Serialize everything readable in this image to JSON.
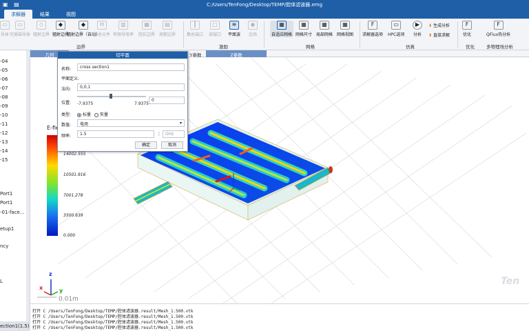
{
  "titlebar": {
    "path": "C:/Users/TenFong/Desktop/TEMP/腔体滤波器.emg"
  },
  "menu": {
    "tabs": [
      "求解器",
      "结果",
      "视图"
    ]
  },
  "ribbon": {
    "buttons": [
      {
        "label": "导体",
        "enabled": false
      },
      {
        "label": "完美磁导体",
        "enabled": false
      },
      {
        "label": "辐射边界",
        "enabled": false
      },
      {
        "label": "辐射边界",
        "enabled": true
      },
      {
        "label": "辐射边界（自动）",
        "enabled": true
      },
      {
        "label": "集总元件",
        "enabled": false
      },
      {
        "label": "有限导电率",
        "enabled": false
      },
      {
        "label": "阻抗边界",
        "enabled": false
      },
      {
        "label": "周期边界",
        "enabled": false
      },
      {
        "label": "集总端口",
        "enabled": false
      },
      {
        "label": "波端口",
        "enabled": false
      },
      {
        "label": "平面波",
        "enabled": true
      },
      {
        "label": "远场",
        "enabled": false
      },
      {
        "label": "自适应网格",
        "enabled": true
      },
      {
        "label": "网格尺寸",
        "enabled": true
      },
      {
        "label": "局部网格",
        "enabled": true
      },
      {
        "label": "网格视图",
        "enabled": true
      },
      {
        "label": "求解器选项",
        "enabled": true
      },
      {
        "label": "HPC选项",
        "enabled": true
      },
      {
        "label": "分析",
        "enabled": true
      },
      {
        "label": "优化",
        "enabled": true
      },
      {
        "label": "QFlux热分析",
        "enabled": true
      }
    ],
    "small_buttons": [
      "生成分析",
      "直接求解"
    ],
    "groups": [
      "边界",
      "激励",
      "网格",
      "仿真",
      "优化",
      "多物理场分析"
    ]
  },
  "tree": {
    "items": [
      "-04",
      "-05",
      "-06",
      "-07",
      "-08",
      "-09",
      "-10",
      "-11",
      "-12",
      "-13",
      "-14",
      "-15",
      "Port1",
      "Port1",
      "-01-face...",
      "etup1",
      "ncy",
      "L"
    ],
    "bottom": "ection1(1.5)"
  },
  "view_tabs": [
    "几何",
    "切平面",
    "Y参数",
    "Z参数"
  ],
  "legend": {
    "title": "E-fie",
    "values": [
      "14002.555",
      "10501.916",
      "7001.278",
      "3500.639",
      "0.000"
    ]
  },
  "axes": {
    "x": "x",
    "y": "y",
    "z": "z",
    "scale": "0.01m"
  },
  "watermark": "Ten",
  "dialog": {
    "title": "切平面",
    "name_label": "名称:",
    "name_value": "cross section1",
    "plane_label": "平面定义:",
    "normal_label": "法向:",
    "normal_value": "0,0,1",
    "position_label": "位置:",
    "position_value": "0",
    "slider_min": "-7.9375",
    "slider_max": "7.9375",
    "type_label": "类型:",
    "type_options": [
      "标量",
      "矢量"
    ],
    "quantity_label": "数值:",
    "quantity_value": "电场",
    "frequency_label": "频率:",
    "frequency_value": "1.5",
    "frequency_unit": "GHz",
    "ok_label": "确定",
    "cancel_label": "取消"
  },
  "log": {
    "lines": [
      "打开 C /Users/TenFong/Desktop/TEMP/腔体滤波器.result/Mesh_1.500.vtk",
      "打开 C /Users/TenFong/Desktop/TEMP/腔体滤波器.result/Mesh_1.500.vtk",
      "打开 C /Users/TenFong/Desktop/TEMP/腔体滤波器.result/Mesh_1.500.vtk",
      "打开 C /Users/TenFong/Desktop/TEMP/腔体滤波器.result/Mesh_1.500.vtk"
    ]
  }
}
